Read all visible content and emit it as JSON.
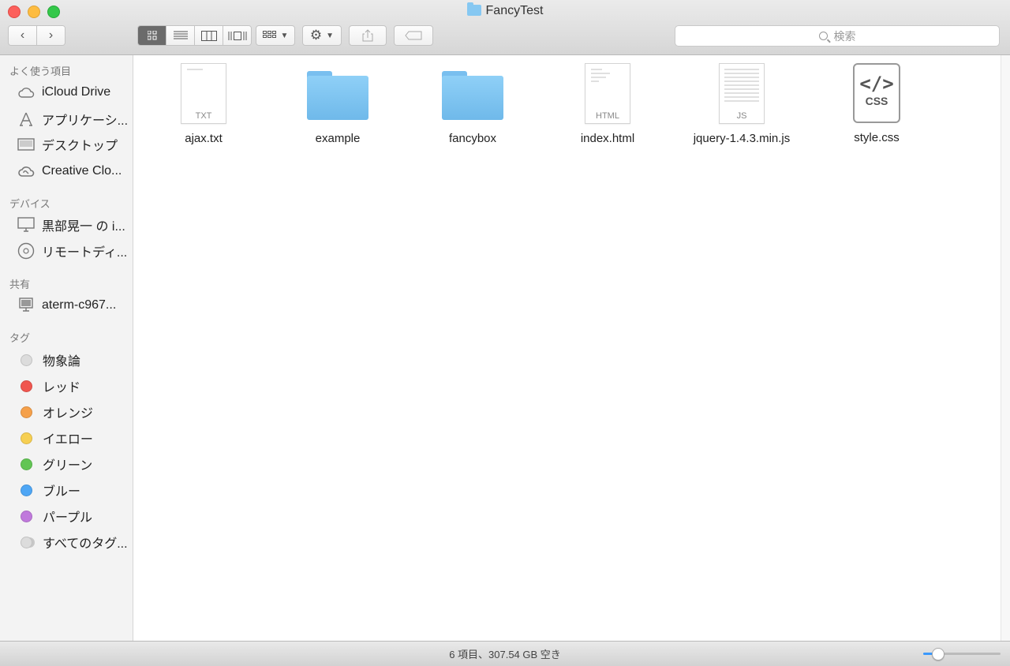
{
  "window": {
    "title": "FancyTest"
  },
  "toolbar": {
    "back_icon": "chevron-left-icon",
    "forward_icon": "chevron-right-icon",
    "view_modes": [
      "icon-view",
      "list-view",
      "column-view",
      "cover-flow-view"
    ],
    "arrange_icon": "group-grid-icon",
    "action_icon": "gear-icon",
    "share_icon": "share-icon",
    "tag_icon": "tag-icon"
  },
  "search": {
    "placeholder": "検索"
  },
  "sidebar": {
    "favorites_header": "よく使う項目",
    "favorites": [
      {
        "label": "iCloud Drive",
        "icon": "cloud-icon"
      },
      {
        "label": "アプリケーシ...",
        "icon": "applications-icon"
      },
      {
        "label": "デスクトップ",
        "icon": "desktop-icon"
      },
      {
        "label": "Creative Clo...",
        "icon": "creative-cloud-icon"
      }
    ],
    "devices_header": "デバイス",
    "devices": [
      {
        "label": "黒部晃一 の i...",
        "icon": "imac-icon"
      },
      {
        "label": "リモートディ...",
        "icon": "disc-icon"
      }
    ],
    "shared_header": "共有",
    "shared": [
      {
        "label": "aterm-c967...",
        "icon": "network-computer-icon"
      }
    ],
    "tags_header": "タグ",
    "tags": [
      {
        "label": "物象論",
        "color": "#dcdcdc"
      },
      {
        "label": "レッド",
        "color": "#f0564f"
      },
      {
        "label": "オレンジ",
        "color": "#f5a04a"
      },
      {
        "label": "イエロー",
        "color": "#f6cf52"
      },
      {
        "label": "グリーン",
        "color": "#62c554"
      },
      {
        "label": "ブルー",
        "color": "#4ea6f5"
      },
      {
        "label": "パープル",
        "color": "#c079dc"
      },
      {
        "label": "すべてのタグ...",
        "color": "#dcdcdc"
      }
    ]
  },
  "files": [
    {
      "name": "ajax.txt",
      "kind": "document",
      "ext": "TXT"
    },
    {
      "name": "example",
      "kind": "folder"
    },
    {
      "name": "fancybox",
      "kind": "folder"
    },
    {
      "name": "index.html",
      "kind": "document",
      "ext": "HTML"
    },
    {
      "name": "jquery-1.4.3.min.js",
      "kind": "document",
      "ext": "JS"
    },
    {
      "name": "style.css",
      "kind": "css",
      "ext": "CSS",
      "symbol": "</>"
    }
  ],
  "status": {
    "text": "6 項目、307.54 GB 空き"
  },
  "icon_size_slider": {
    "value_fraction": 0.18
  }
}
